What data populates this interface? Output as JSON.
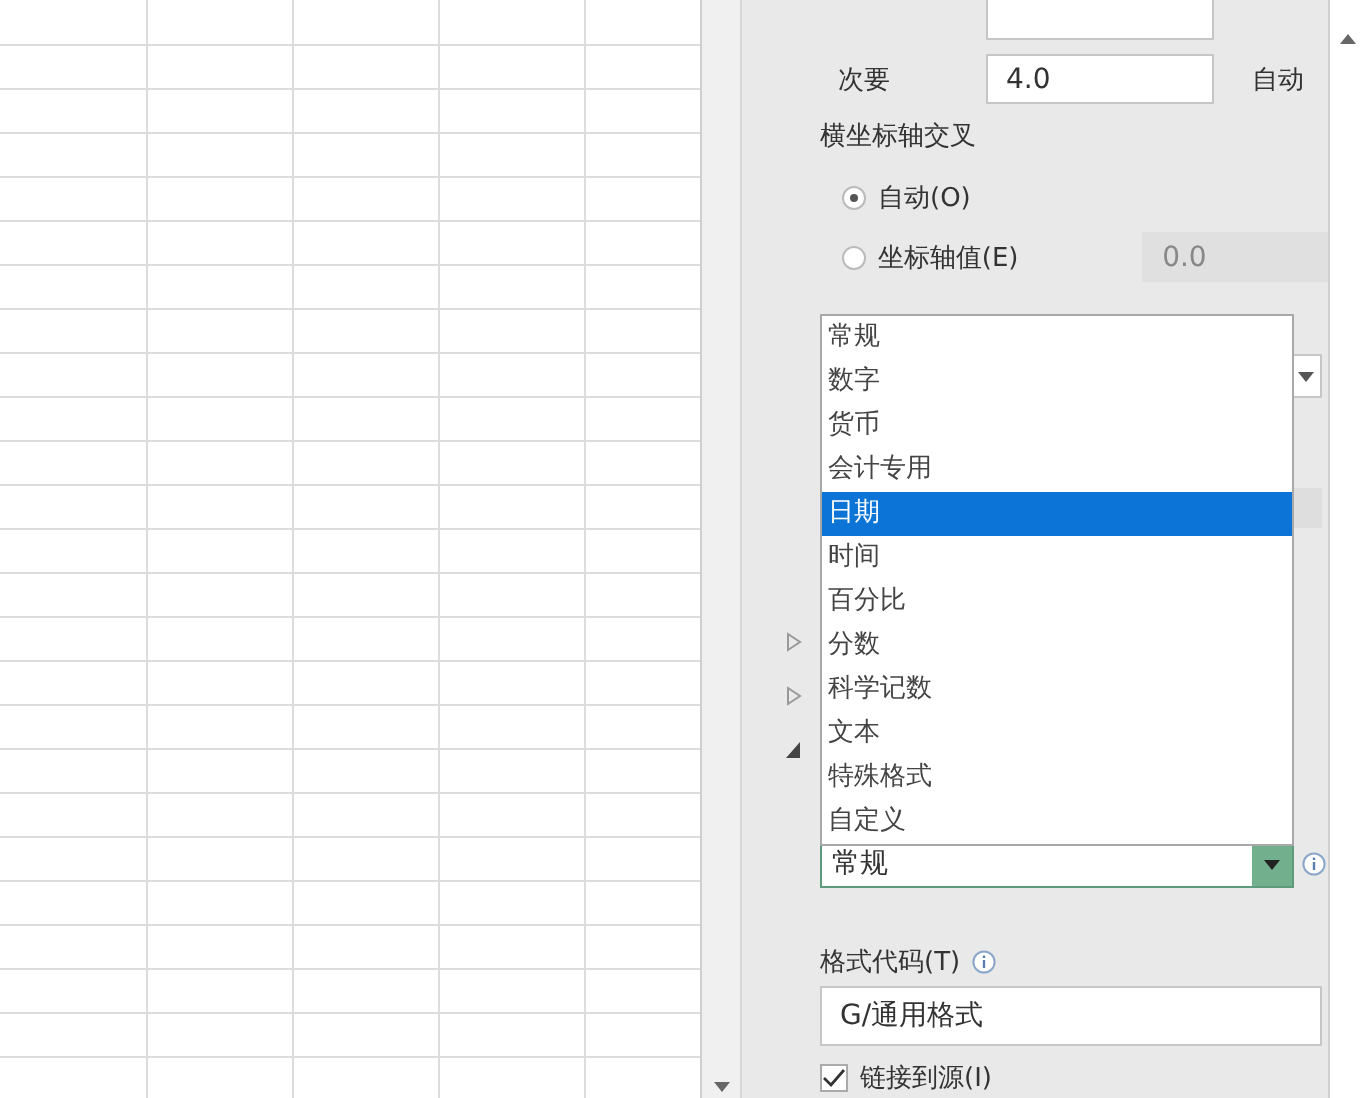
{
  "axis_units": [
    {
      "label": "次要",
      "value": "4.0",
      "auto": "自动"
    }
  ],
  "axis_cross": {
    "title": "横坐标轴交叉",
    "options": [
      {
        "label": "自动(O)",
        "selected": true
      },
      {
        "label": "坐标轴值(E)",
        "selected": false,
        "value": "0.0"
      }
    ]
  },
  "sections": [
    {
      "expanded": false
    },
    {
      "expanded": false
    },
    {
      "expanded": true
    }
  ],
  "number_category": {
    "value": "常规",
    "options": [
      {
        "label": "常规",
        "highlighted": false
      },
      {
        "label": "数字",
        "highlighted": false
      },
      {
        "label": "货币",
        "highlighted": false
      },
      {
        "label": "会计专用",
        "highlighted": false
      },
      {
        "label": "日期",
        "highlighted": true
      },
      {
        "label": "时间",
        "highlighted": false
      },
      {
        "label": "百分比",
        "highlighted": false
      },
      {
        "label": "分数",
        "highlighted": false
      },
      {
        "label": "科学记数",
        "highlighted": false
      },
      {
        "label": "文本",
        "highlighted": false
      },
      {
        "label": "特殊格式",
        "highlighted": false
      },
      {
        "label": "自定义",
        "highlighted": false
      }
    ]
  },
  "format_code": {
    "label": "格式代码(T)",
    "value": "G/通用格式"
  },
  "link_to_source": {
    "label": "链接到源(I)",
    "checked": true
  }
}
